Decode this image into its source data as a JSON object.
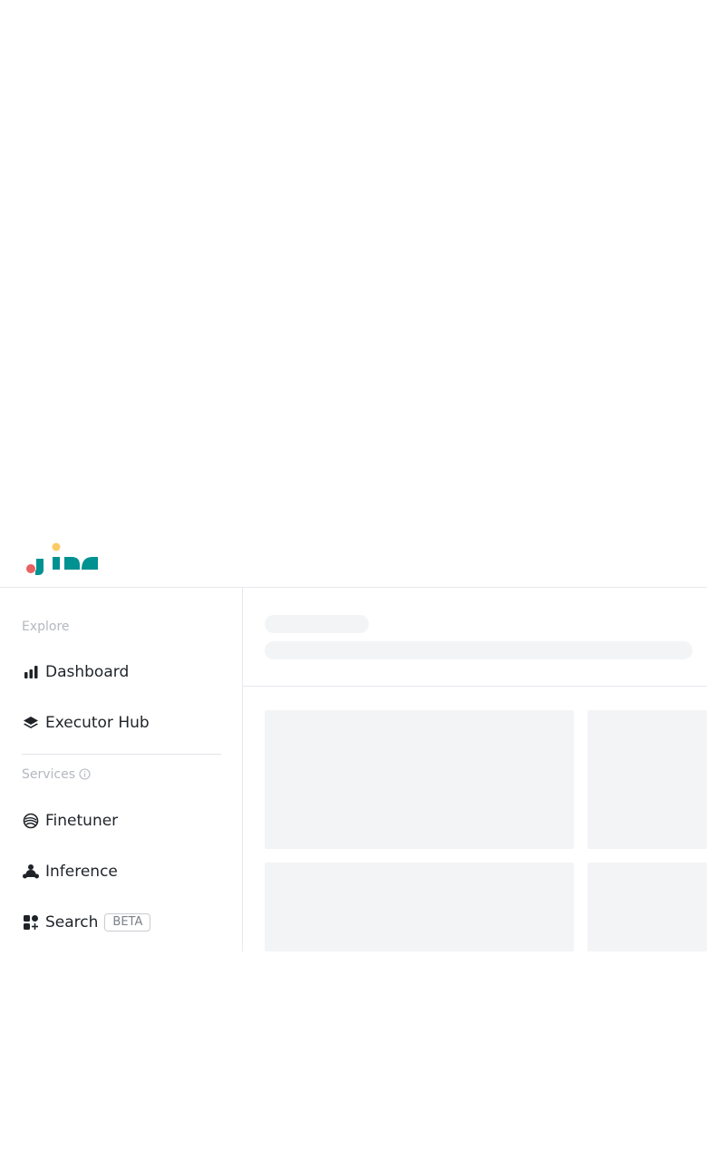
{
  "brand": {
    "logo_text": "jina",
    "colors": {
      "teal": "#009191",
      "yellow": "#fbcb67",
      "red": "#eb6161"
    }
  },
  "sidebar": {
    "explore_label": "Explore",
    "explore_items": [
      {
        "label": "Dashboard",
        "icon": "bar-chart-icon"
      },
      {
        "label": "Executor Hub",
        "icon": "stack-layers-icon"
      }
    ],
    "services_label": "Services",
    "services_items": [
      {
        "label": "Finetuner",
        "icon": "finetuner-icon"
      },
      {
        "label": "Inference",
        "icon": "inference-icon"
      },
      {
        "label": "Search",
        "icon": "search-grid-plus-icon",
        "badge": "BETA"
      }
    ]
  },
  "main": {
    "state": "loading",
    "skeleton_color": "#f3f4f6"
  }
}
